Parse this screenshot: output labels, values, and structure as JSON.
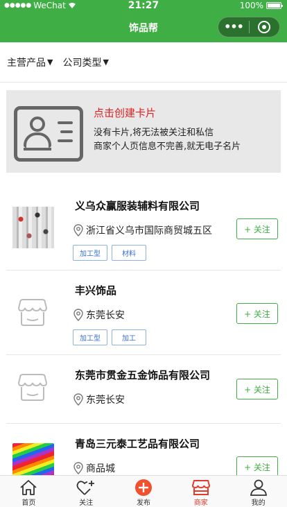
{
  "status_bar": {
    "signal": "●●●●●",
    "carrier": "WeChat",
    "time": "21:27",
    "battery": "100%"
  },
  "nav": {
    "title": "饰品帮",
    "more_label": "•••"
  },
  "filters": [
    {
      "label": "主营产品",
      "caret": "▼"
    },
    {
      "label": "公司类型",
      "caret": "▼"
    }
  ],
  "banner": {
    "title": "点击创建卡片",
    "line1": "没有卡片,将无法被关注和私信",
    "line2": "商家个人页信息不完善,就无电子名片"
  },
  "companies": [
    {
      "name": "义乌众赢服装辅料有限公司",
      "location": "浙江省义乌市国际商贸城五区",
      "tags": [
        "加工型",
        "材料"
      ],
      "follow": "+ 关注",
      "thumb": "photo"
    },
    {
      "name": "丰兴饰品",
      "location": "东莞长安",
      "tags": [
        "加工型",
        "加工"
      ],
      "follow": "+ 关注",
      "thumb": "shop-icon"
    },
    {
      "name": "东莞市贯金五金饰品有限公司",
      "location": "东莞长安",
      "tags": [],
      "follow": "+ 关注",
      "thumb": "shop-icon"
    },
    {
      "name": "青岛三元泰工艺品有限公司",
      "location": "商品城",
      "tags": [],
      "follow": "+ 关注",
      "thumb": "photo"
    }
  ],
  "tabbar": [
    {
      "label": "首页",
      "icon": "home-icon"
    },
    {
      "label": "关注",
      "icon": "heart-plus-icon"
    },
    {
      "label": "发布",
      "icon": "plus-circle-icon"
    },
    {
      "label": "商家",
      "icon": "shop-icon",
      "active": true
    },
    {
      "label": "我的",
      "icon": "user-icon"
    }
  ],
  "colors": {
    "primary": "#3fae44",
    "accent_red": "#e23b2b",
    "banner_title": "#e02020",
    "tag_blue": "#3a6fd0"
  }
}
